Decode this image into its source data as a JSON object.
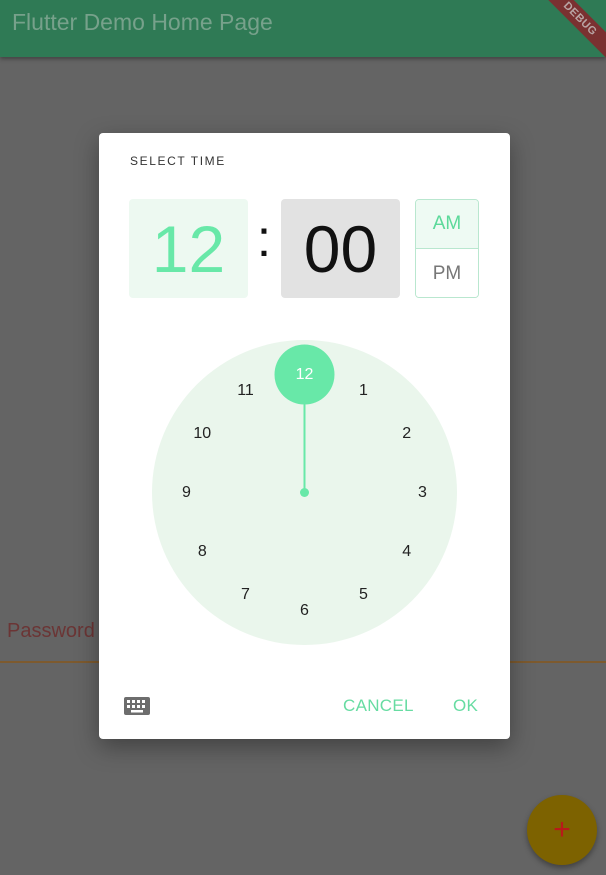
{
  "app_bar": {
    "title": "Flutter Demo Home Page",
    "debug_banner": "DEBUG"
  },
  "form": {
    "password_label": "Password"
  },
  "fab": {
    "icon": "plus-icon",
    "glyph": "+"
  },
  "time_picker": {
    "title": "SELECT TIME",
    "hour": "12",
    "separator": ":",
    "minute": "00",
    "am_label": "AM",
    "pm_label": "PM",
    "selected_period": "AM",
    "selected_hour": "12",
    "dial_numbers": [
      "12",
      "1",
      "2",
      "3",
      "4",
      "5",
      "6",
      "7",
      "8",
      "9",
      "10",
      "11"
    ],
    "cancel_label": "CANCEL",
    "ok_label": "OK",
    "input_mode_icon": "keyboard-icon"
  },
  "colors": {
    "accent": "#68e8a8",
    "dial_background": "#eaf6ec",
    "app_bar": "#2f7a55",
    "scrim": "#646464"
  }
}
